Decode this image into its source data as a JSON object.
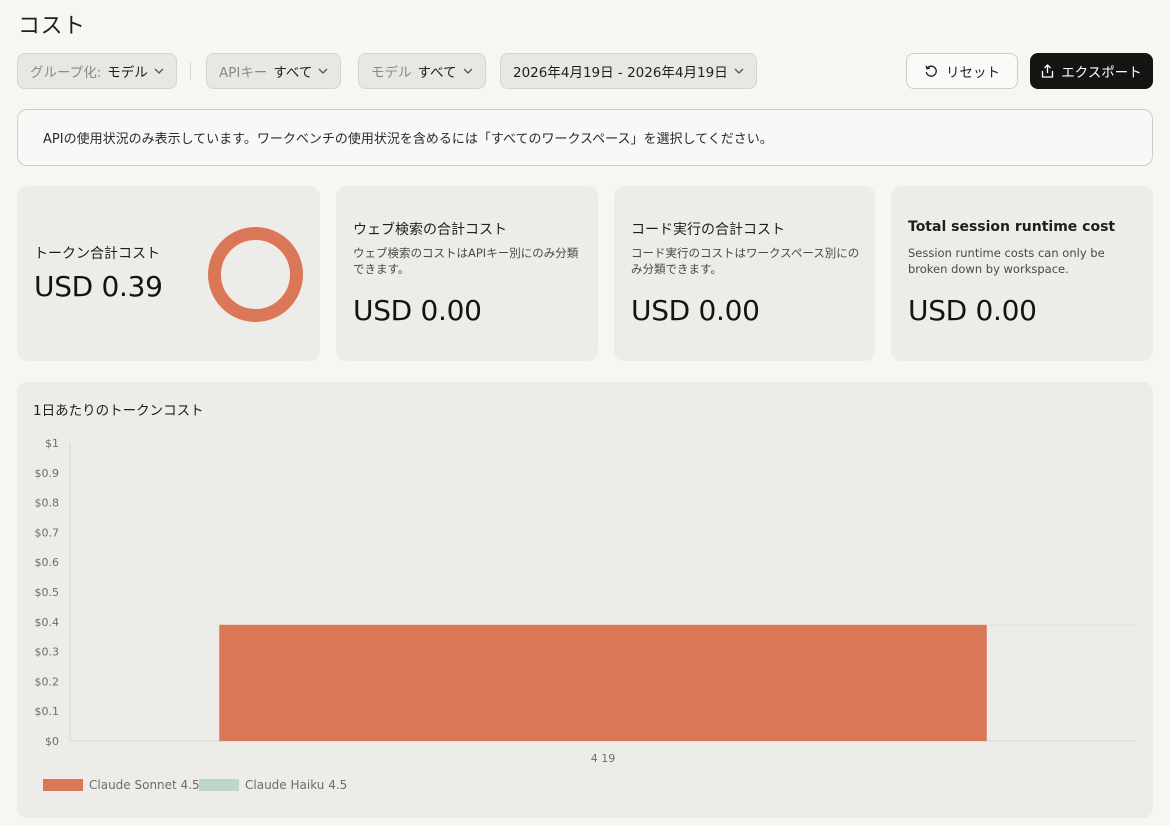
{
  "page": {
    "title": "コスト"
  },
  "filters": {
    "group": {
      "label": "グループ化:",
      "value": "モデル"
    },
    "api_key": {
      "label": "APIキー",
      "value": "すべて"
    },
    "model": {
      "label": "モデル",
      "value": "すべて"
    },
    "date_range": {
      "value": "2026年4月19日 - 2026年4月19日"
    }
  },
  "actions": {
    "reset_label": "リセット",
    "export_label": "エクスポート"
  },
  "notice": {
    "text": "APIの使用状況のみ表示しています。ワークベンチの使用状況を含めるには「すべてのワークスペース」を選択してください。"
  },
  "cards": {
    "token": {
      "title": "トークン合計コスト",
      "value": "USD 0.39",
      "ring_color": "#d97757"
    },
    "web_search": {
      "title": "ウェブ検索の合計コスト",
      "desc": "ウェブ検索のコストはAPIキー別にのみ分類できます。",
      "value": "USD 0.00"
    },
    "code_exec": {
      "title": "コード実行の合計コスト",
      "desc": "コード実行のコストはワークスペース別にのみ分類できます。",
      "value": "USD 0.00"
    },
    "session": {
      "title": "Total session runtime cost",
      "desc": "Session runtime costs can only be broken down by workspace.",
      "value": "USD 0.00"
    }
  },
  "chart_data": {
    "type": "bar",
    "title": "1日あたりのトークンコスト",
    "categories": [
      "4 19"
    ],
    "yticks": [
      "$0",
      "$0.1",
      "$0.2",
      "$0.3",
      "$0.4",
      "$0.5",
      "$0.6",
      "$0.7",
      "$0.8",
      "$0.9",
      "$1"
    ],
    "ylim": [
      0,
      1
    ],
    "stacked": true,
    "series": [
      {
        "name": "Claude Sonnet 4.5",
        "color": "#d97757",
        "values": [
          0.39
        ]
      },
      {
        "name": "Claude Haiku 4.5",
        "color": "#bcd6cb",
        "values": [
          0
        ]
      }
    ],
    "legend": "bottom-left"
  }
}
